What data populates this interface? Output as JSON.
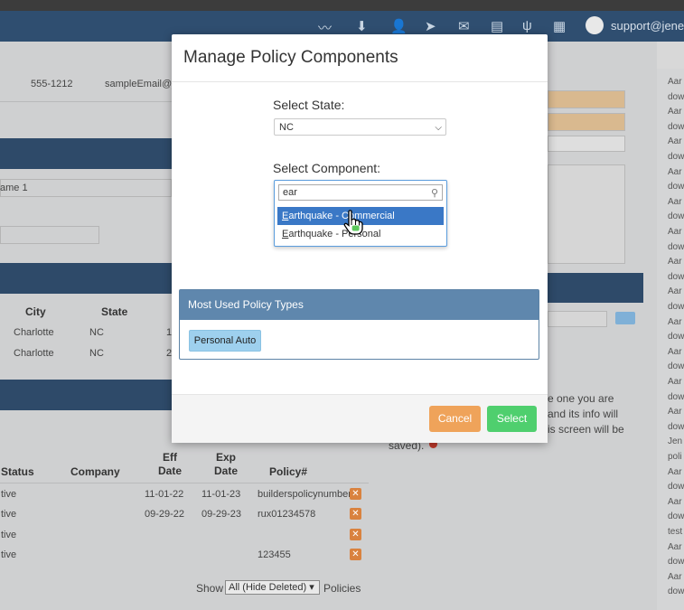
{
  "topbar": {
    "user": "support@jenes",
    "icons": [
      "chart-line-icon",
      "download-icon",
      "user-plus-icon",
      "send-icon",
      "envelope-icon",
      "document-icon",
      "fork-knife-icon",
      "calendar-icon"
    ]
  },
  "background": {
    "contact": {
      "phone": "555-1212",
      "email": "sampleEmail@je"
    },
    "name_field": "ame 1",
    "address_headers": {
      "city": "City",
      "state": "State"
    },
    "address_rows": [
      {
        "city": "Charlotte",
        "state": "NC",
        "extra": "1"
      },
      {
        "city": "Charlotte",
        "state": "NC",
        "extra": "2"
      }
    ],
    "policy_headers": {
      "status": "Status",
      "company": "Company",
      "eff": "Eff Date",
      "exp": "Exp Date",
      "policy": "Policy#"
    },
    "policy_rows": [
      {
        "status": "tive",
        "eff": "11-01-22",
        "exp": "11-01-23",
        "policy": "builderspolicynumber"
      },
      {
        "status": "tive",
        "eff": "09-29-22",
        "exp": "09-29-23",
        "policy": "rux01234578"
      },
      {
        "status": "tive",
        "eff": "",
        "exp": "",
        "policy": ""
      },
      {
        "status": "tive",
        "eff": "",
        "exp": "",
        "policy": "123455"
      }
    ],
    "show_label": "Show",
    "show_select": "All (Hide Deleted)",
    "policies_label": "Policies",
    "note_lines": [
      "e one you are",
      "and its info will",
      "is screen will be",
      "saved)."
    ],
    "right_list": [
      "Aar",
      "dow",
      "Aar",
      "dow",
      "Aar",
      "dow",
      "Aar",
      "dow",
      "Aar",
      "dow",
      "Aar",
      "dow",
      "Aar",
      "dow",
      "Aar",
      "dow",
      "Aar",
      "dow",
      "Aar",
      "dow",
      "Aar",
      "dow",
      "Aar",
      "dow",
      "Jen",
      "poli",
      "Aar",
      "dow",
      "Aar",
      "dow",
      "test",
      "Aar",
      "dow",
      "Aar",
      "dow"
    ]
  },
  "modal": {
    "title": "Manage Policy Components",
    "state_label": "Select State:",
    "state_value": "NC",
    "component_label": "Select Component:",
    "search_value": "ear",
    "options": [
      {
        "match": "E",
        "rest": "arthquake - Commercial",
        "highlighted": true
      },
      {
        "match": "E",
        "rest": "arthquake - Personal",
        "highlighted": false
      }
    ],
    "panel_title": "Most Used Policy Types",
    "policy_type": "Personal Auto",
    "cancel": "Cancel",
    "select": "Select"
  },
  "colors": {
    "header": "#2f4e70",
    "highlight": "#3a78c6",
    "cancel": "#efa35a",
    "select": "#4fcf6e",
    "panel": "#5f87ad"
  }
}
